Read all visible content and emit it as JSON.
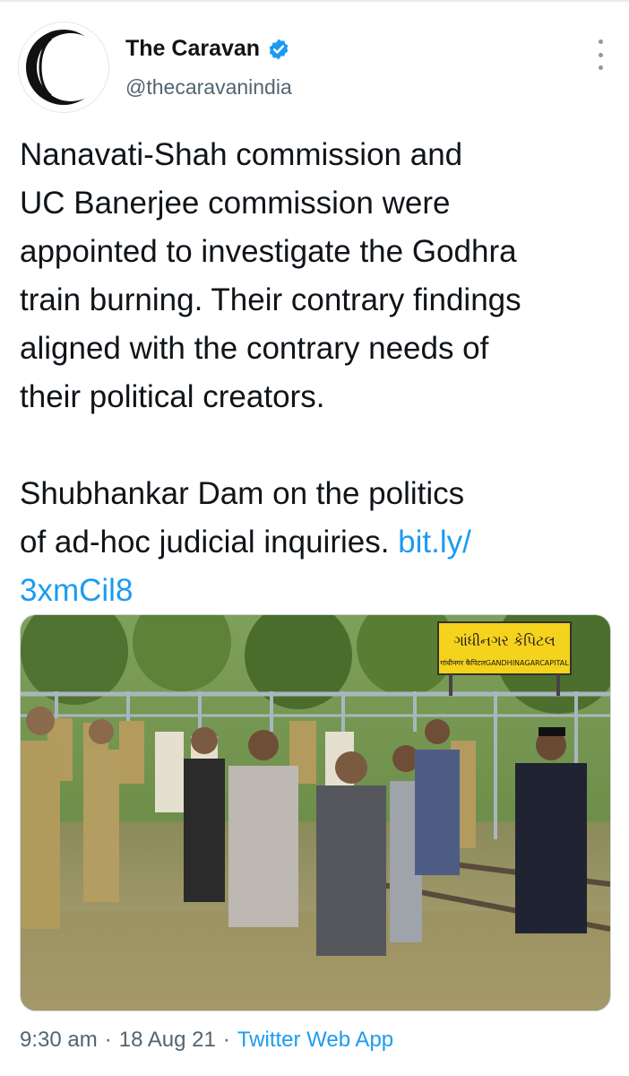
{
  "account": {
    "name": "The Caravan",
    "handle": "@thecaravanindia",
    "verified": true,
    "avatar_icon": "caravan-logo-icon"
  },
  "tweet": {
    "paragraph1": "Nanavati-Shah commission and\nUC Banerjee commission were\nappointed to investigate the Godhra\ntrain burning. Their contrary findings\naligned with the contrary needs of\ntheir political creators.",
    "paragraph2_text": "Shubhankar Dam on the politics\nof ad-hoc judicial inquiries. ",
    "link_part1": "bit.ly/",
    "link_part2": "3xmCil8"
  },
  "media": {
    "sign_gujarati": "ગાંધીનગર કેપિટલ",
    "sign_hindi_english": "गांधीनगर कैपिटलGANDHINAGARCAPITAL"
  },
  "footer": {
    "time": "9:30 am",
    "separator": "·",
    "date": "18 Aug 21",
    "app": "Twitter Web App"
  },
  "colors": {
    "link": "#1d9bf0",
    "secondary_text": "#536471",
    "verified": "#1d9bf0"
  }
}
